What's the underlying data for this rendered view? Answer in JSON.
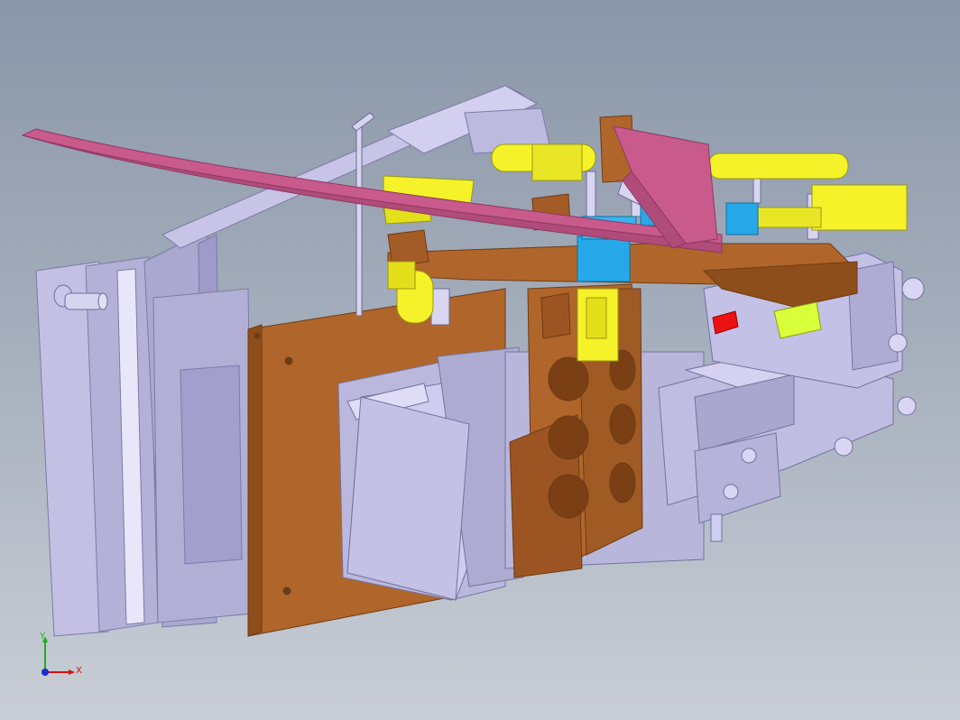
{
  "viewport": {
    "background_top": "#8a96a8",
    "background_bottom": "#c9ced6"
  },
  "model": {
    "frame_color": "#b9b6dc",
    "plate_color": "#b0652a",
    "cylinder_color": "#f5f22a",
    "block_color": "#27a8e8",
    "strip_color": "#c85a8c",
    "marker_color": "#ee1111"
  },
  "triad": {
    "x_label": "X",
    "y_label": "Y",
    "icon": "axis-triad-icon"
  }
}
